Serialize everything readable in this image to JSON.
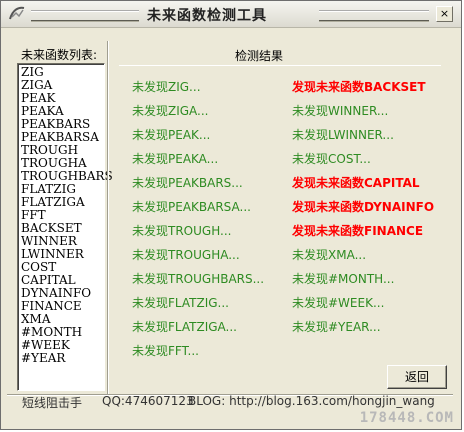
{
  "window": {
    "title": "未来函数检测工具",
    "close_label": "×"
  },
  "list": {
    "header": "未来函数列表:",
    "items": [
      "ZIG",
      "ZIGA",
      "PEAK",
      "PEAKA",
      "PEAKBARS",
      "PEAKBARSA",
      "TROUGH",
      "TROUGHA",
      "TROUGHBARS",
      "FLATZIG",
      "FLATZIGA",
      "FFT",
      "BACKSET",
      "WINNER",
      "LWINNER",
      "COST",
      "CAPITAL",
      "DYNAINFO",
      "FINANCE",
      "XMA",
      "#MONTH",
      "#WEEK",
      "#YEAR"
    ]
  },
  "results": {
    "header": "检测结果",
    "col1": [
      {
        "text": "未发现ZIG...",
        "found": false
      },
      {
        "text": "未发现ZIGA...",
        "found": false
      },
      {
        "text": "未发现PEAK...",
        "found": false
      },
      {
        "text": "未发现PEAKA...",
        "found": false
      },
      {
        "text": "未发现PEAKBARS...",
        "found": false
      },
      {
        "text": "未发现PEAKBARSA...",
        "found": false
      },
      {
        "text": "未发现TROUGH...",
        "found": false
      },
      {
        "text": "未发现TROUGHA...",
        "found": false
      },
      {
        "text": "未发现TROUGHBARS...",
        "found": false
      },
      {
        "text": "未发现FLATZIG...",
        "found": false
      },
      {
        "text": "未发现FLATZIGA...",
        "found": false
      },
      {
        "text": "未发现FFT...",
        "found": false
      }
    ],
    "col2": [
      {
        "text": "发现未来函数BACKSET",
        "found": true
      },
      {
        "text": "未发现WINNER...",
        "found": false
      },
      {
        "text": "未发现LWINNER...",
        "found": false
      },
      {
        "text": "未发现COST...",
        "found": false
      },
      {
        "text": "发现未来函数CAPITAL",
        "found": true
      },
      {
        "text": "发现未来函数DYNAINFO",
        "found": true
      },
      {
        "text": "发现未来函数FINANCE",
        "found": true
      },
      {
        "text": "未发现XMA...",
        "found": false
      },
      {
        "text": "未发现#MONTH...",
        "found": false
      },
      {
        "text": "未发现#WEEK...",
        "found": false
      },
      {
        "text": "未发现#YEAR...",
        "found": false
      }
    ],
    "colors": {
      "not_found": "#2e8b22",
      "found": "#ff0000"
    }
  },
  "buttons": {
    "back_label": "返回"
  },
  "footer": {
    "author": "短线阻击手",
    "qq": "QQ:474607123",
    "blog": "BLOG: http://blog.163.com/hongjin_wang"
  },
  "watermark": "178448.COM"
}
